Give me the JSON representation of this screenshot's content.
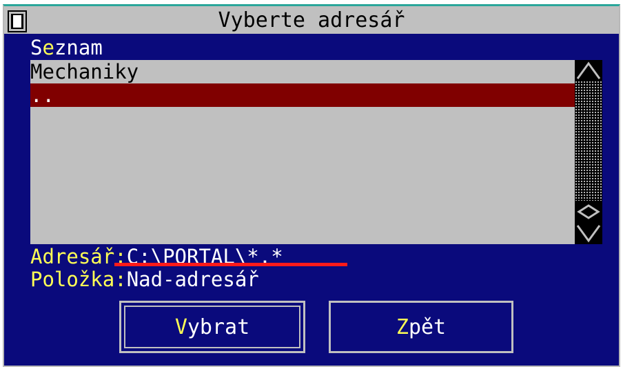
{
  "window": {
    "title": "Vyberte adresář"
  },
  "list": {
    "heading_first": "S",
    "heading_hotkey": "e",
    "heading_rest": "znam",
    "items": [
      {
        "label": "Mechaniky",
        "selected": false
      },
      {
        "label": "..",
        "selected": true
      }
    ]
  },
  "directory": {
    "label": "Adresář:",
    "value": "C:\\PORTAL\\*.*"
  },
  "item": {
    "label": "Položka:",
    "value": "Nad-adresář"
  },
  "buttons": {
    "select": {
      "hotkey": "V",
      "rest": "ybrat"
    },
    "back": {
      "hotkey": "Z",
      "rest": "pět"
    }
  },
  "colors": {
    "dialog_bg": "#0a0a7c",
    "list_bg": "#c0c0c0",
    "selection_bg": "#800000",
    "hotkey": "#ffff55",
    "annotation": "#ff1a1a"
  }
}
